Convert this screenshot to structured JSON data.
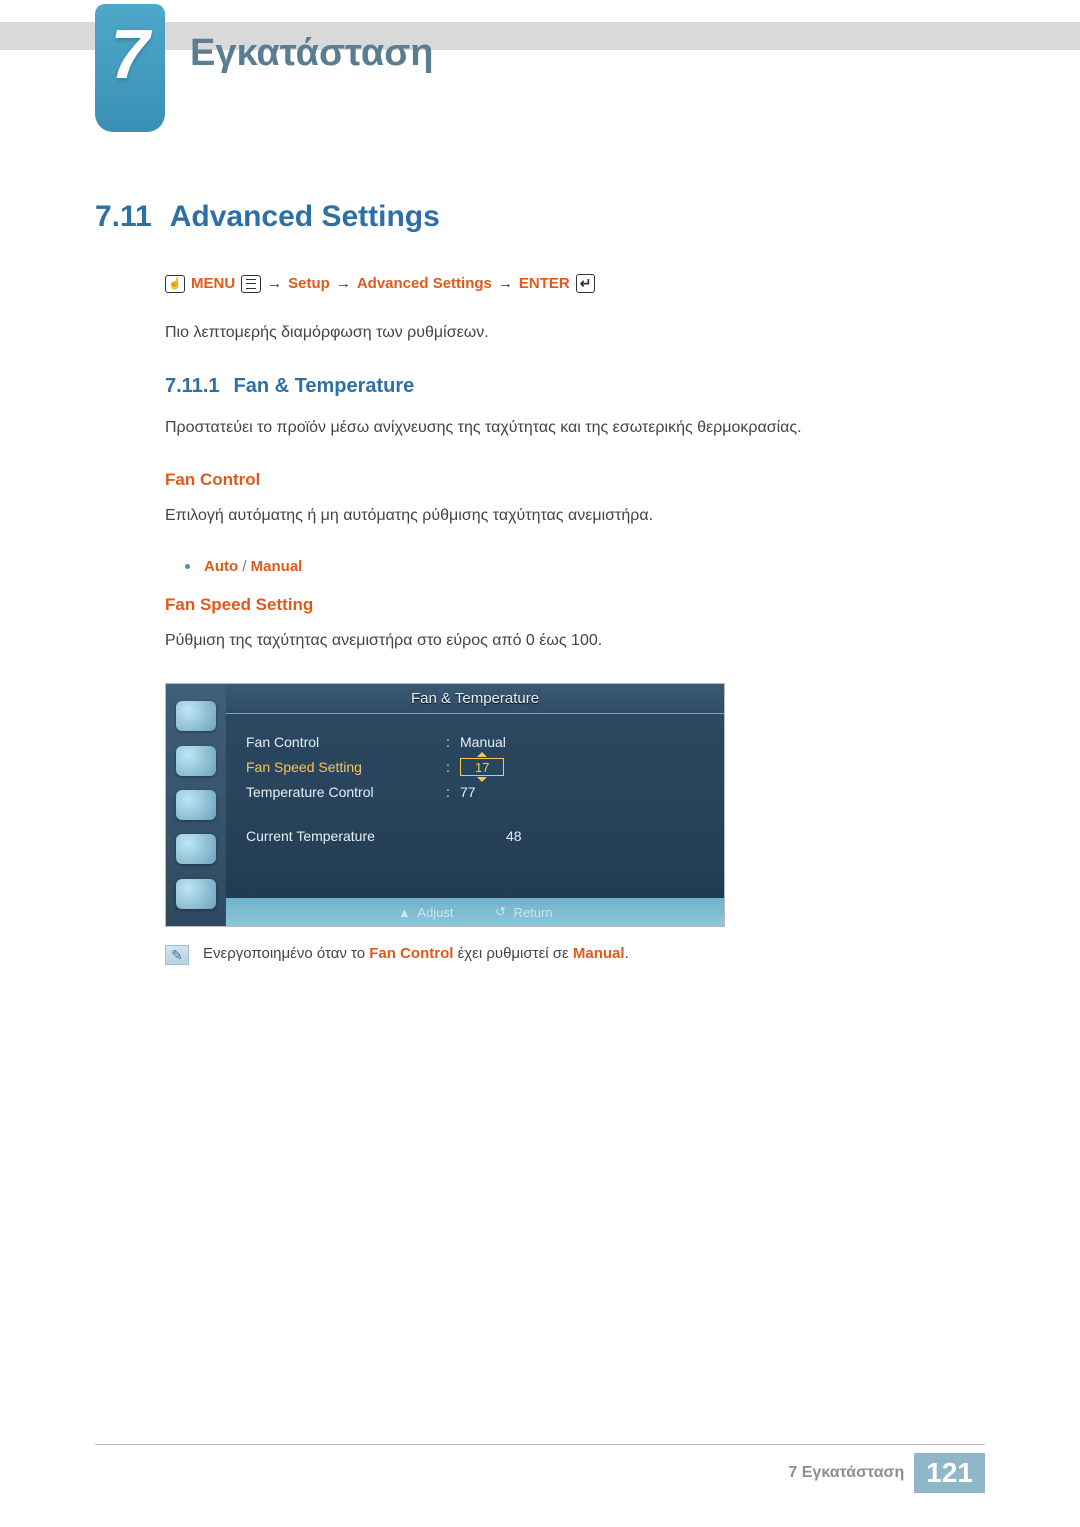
{
  "chapter": {
    "number": "7",
    "title": "Εγκατάσταση"
  },
  "section": {
    "number": "7.11",
    "title": "Advanced Settings"
  },
  "nav": {
    "menu": "MENU",
    "arrow": "→",
    "setup": "Setup",
    "adv": "Advanced Settings",
    "enter": "ENTER"
  },
  "text": {
    "intro": "Πιο λεπτομερής διαμόρφωση των ρυθμίσεων.",
    "fan_temp_desc": "Προστατεύει το προϊόν μέσω ανίχνευσης της ταχύτητας και της εσωτερικής θερμοκρασίας.",
    "fan_control_desc": "Επιλογή αυτόματης ή μη αυτόματης ρύθμισης ταχύτητας ανεμιστήρα.",
    "fan_speed_desc": "Ρύθμιση της ταχύτητας ανεμιστήρα στο εύρος από 0 έως 100."
  },
  "subsection": {
    "number": "7.11.1",
    "title": "Fan & Temperature"
  },
  "heading_fan_control": "Fan Control",
  "heading_fan_speed": "Fan Speed Setting",
  "options": {
    "auto": "Auto",
    "sep": "/",
    "manual": "Manual"
  },
  "osd": {
    "title": "Fan & Temperature",
    "rows": {
      "fan_control": {
        "label": "Fan Control",
        "value": "Manual"
      },
      "fan_speed": {
        "label": "Fan Speed Setting",
        "value": "17"
      },
      "temp_ctrl": {
        "label": "Temperature Control",
        "value": "77"
      }
    },
    "current": {
      "label": "Current Temperature",
      "value": "48"
    },
    "footer": {
      "adjust": "Adjust",
      "return": "Return"
    }
  },
  "note": {
    "pre": "Ενεργοποιημένο όταν το ",
    "fc": "Fan Control",
    "mid": " έχει ρυθμιστεί σε ",
    "manual": "Manual",
    "post": "."
  },
  "footer": {
    "label": "7 Εγκατάσταση",
    "page": "121"
  }
}
